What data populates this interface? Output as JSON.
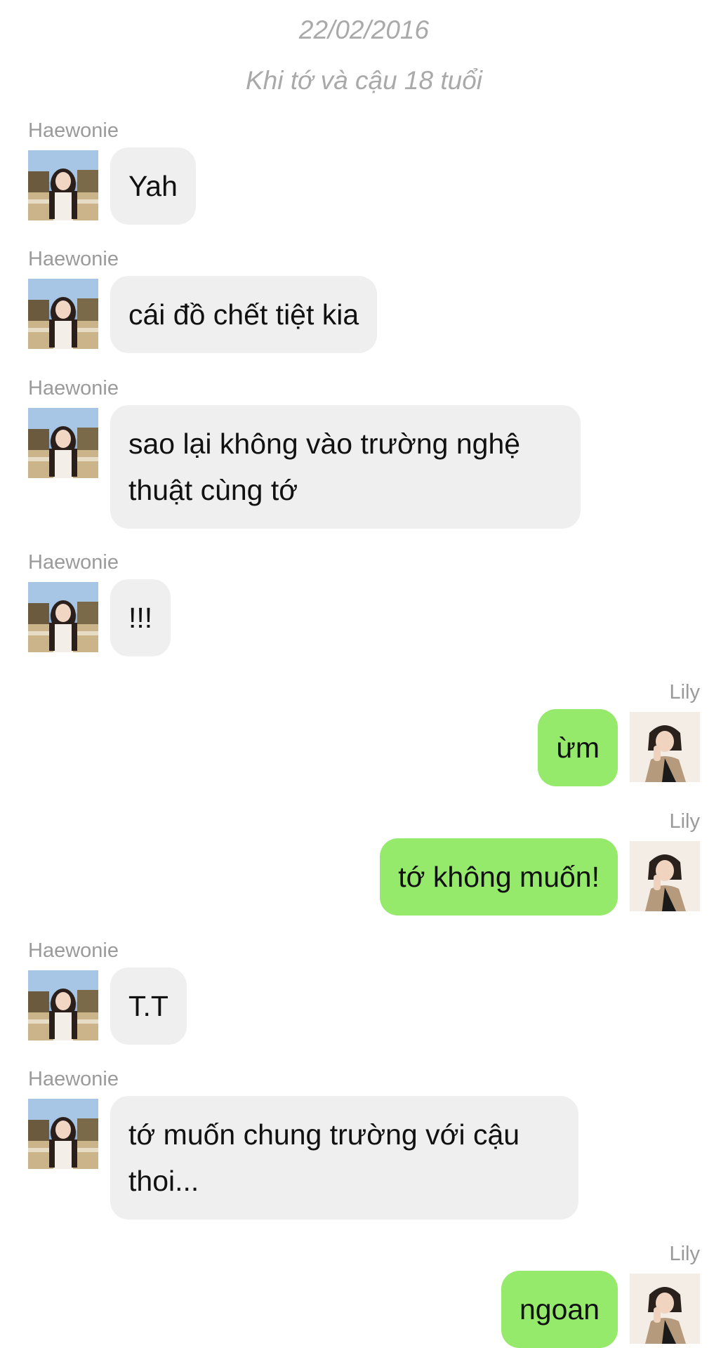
{
  "header": {
    "date": "22/02/2016",
    "note": "Khi tớ và cậu 18 tuổi"
  },
  "colors": {
    "incoming_bubble": "#efefef",
    "outgoing_bubble": "#95e96b",
    "meta_text": "#a9a9a9"
  },
  "messages": [
    {
      "sender": "Haewonie",
      "text": "Yah",
      "side": "left"
    },
    {
      "sender": "Haewonie",
      "text": "cái đồ chết tiệt kia",
      "side": "left"
    },
    {
      "sender": "Haewonie",
      "text": "sao lại không vào trường nghệ thuật cùng tớ",
      "side": "left"
    },
    {
      "sender": "Haewonie",
      "text": "!!!",
      "side": "left"
    },
    {
      "sender": "Lily",
      "text": "ừm",
      "side": "right"
    },
    {
      "sender": "Lily",
      "text": "tớ không muốn!",
      "side": "right"
    },
    {
      "sender": "Haewonie",
      "text": "T.T",
      "side": "left"
    },
    {
      "sender": "Haewonie",
      "text": "tớ muốn chung trường với cậu thoi...",
      "side": "left"
    },
    {
      "sender": "Lily",
      "text": "ngoan",
      "side": "right"
    }
  ]
}
